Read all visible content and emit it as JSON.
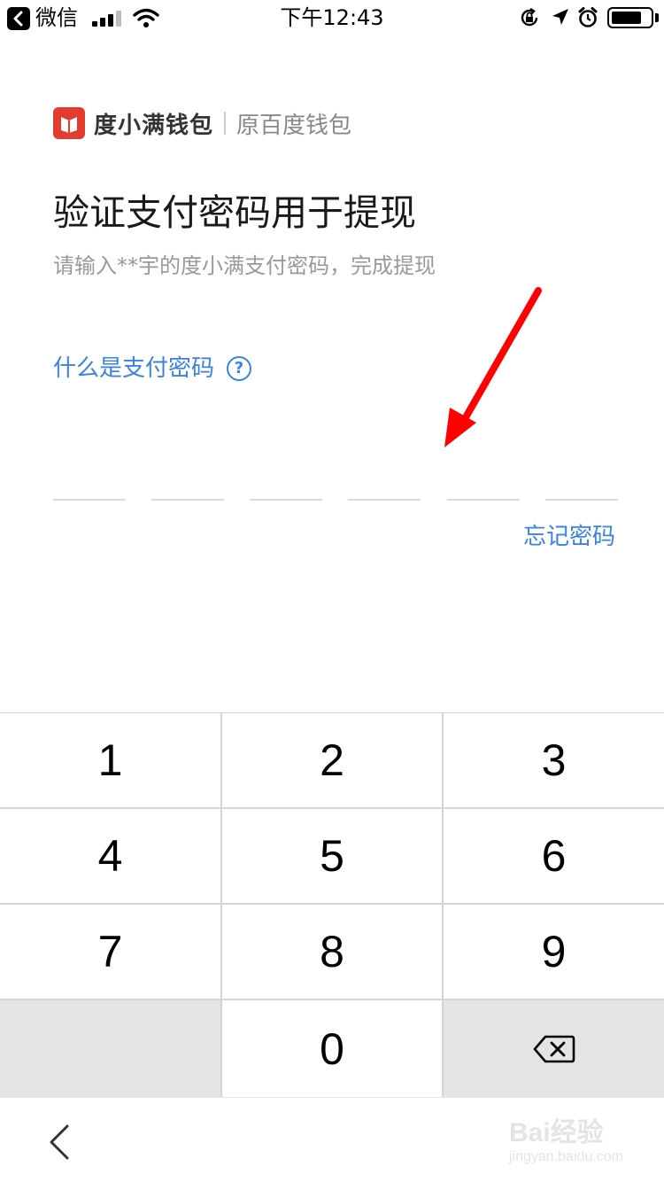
{
  "status_bar": {
    "back_app": "微信",
    "time": "下午12:43",
    "battery_level": 0.75
  },
  "brand": {
    "name": "度小满钱包",
    "subtitle": "原百度钱包"
  },
  "page": {
    "title": "验证支付密码用于提现",
    "subtitle": "请输入**宇的度小满支付密码，完成提现",
    "help_link": "什么是支付密码",
    "help_icon_glyph": "?",
    "pin_length": 6,
    "forgot_link": "忘记密码"
  },
  "keypad": {
    "keys": [
      "1",
      "2",
      "3",
      "4",
      "5",
      "6",
      "7",
      "8",
      "9",
      "",
      "0",
      "delete"
    ]
  },
  "icons": {
    "back": "chevron-left-icon",
    "delete": "backspace-icon",
    "help": "question-circle-icon"
  },
  "watermark": {
    "top": "Bai经验",
    "bottom": "jingyan.baidu.com"
  },
  "colors": {
    "accent": "#3a82e5",
    "brand": "#e33b30",
    "annotation_arrow": "#ff0000"
  }
}
